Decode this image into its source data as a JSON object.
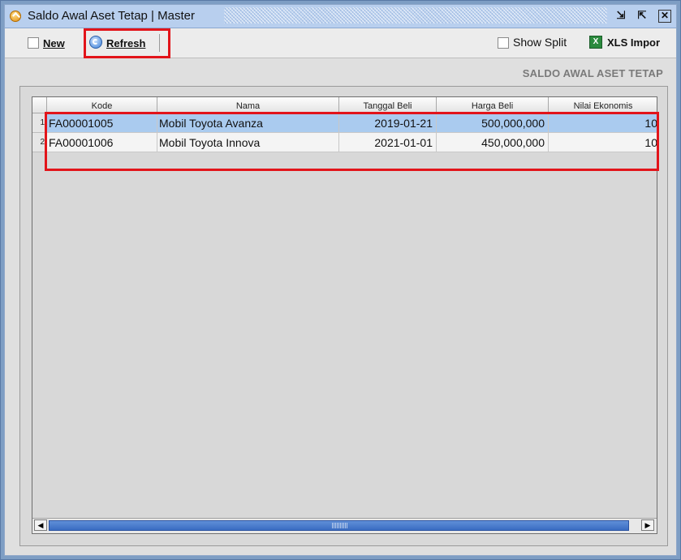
{
  "window": {
    "title": "Saldo Awal Aset Tetap | Master",
    "restore_glyph": "⇲",
    "maximize_glyph": "⇱",
    "close_glyph": "☒"
  },
  "toolbar": {
    "new_label": "New",
    "refresh_label": "Refresh",
    "show_split_label": "Show Split",
    "xls_label": "XLS Impor",
    "xls_icon_text": "X"
  },
  "section_title": "SALDO AWAL ASET TETAP",
  "table": {
    "columns": [
      "Kode",
      "Nama",
      "Tanggal Beli",
      "Harga Beli",
      "Nilai Ekonomis"
    ],
    "rows": [
      {
        "num": "1",
        "kode": "FA00001005",
        "nama": "Mobil Toyota Avanza",
        "tanggal": "2019-01-21",
        "harga": "500,000,000",
        "nilai": "10"
      },
      {
        "num": "2",
        "kode": "FA00001006",
        "nama": "Mobil Toyota Innova",
        "tanggal": "2021-01-01",
        "harga": "450,000,000",
        "nilai": "10"
      }
    ]
  },
  "scrollbar": {
    "left_arrow": "◀",
    "right_arrow": "▶"
  },
  "colors": {
    "selected_row": "#aacbef",
    "highlight": "#e2141a",
    "titlebar": "#b8cfee"
  }
}
